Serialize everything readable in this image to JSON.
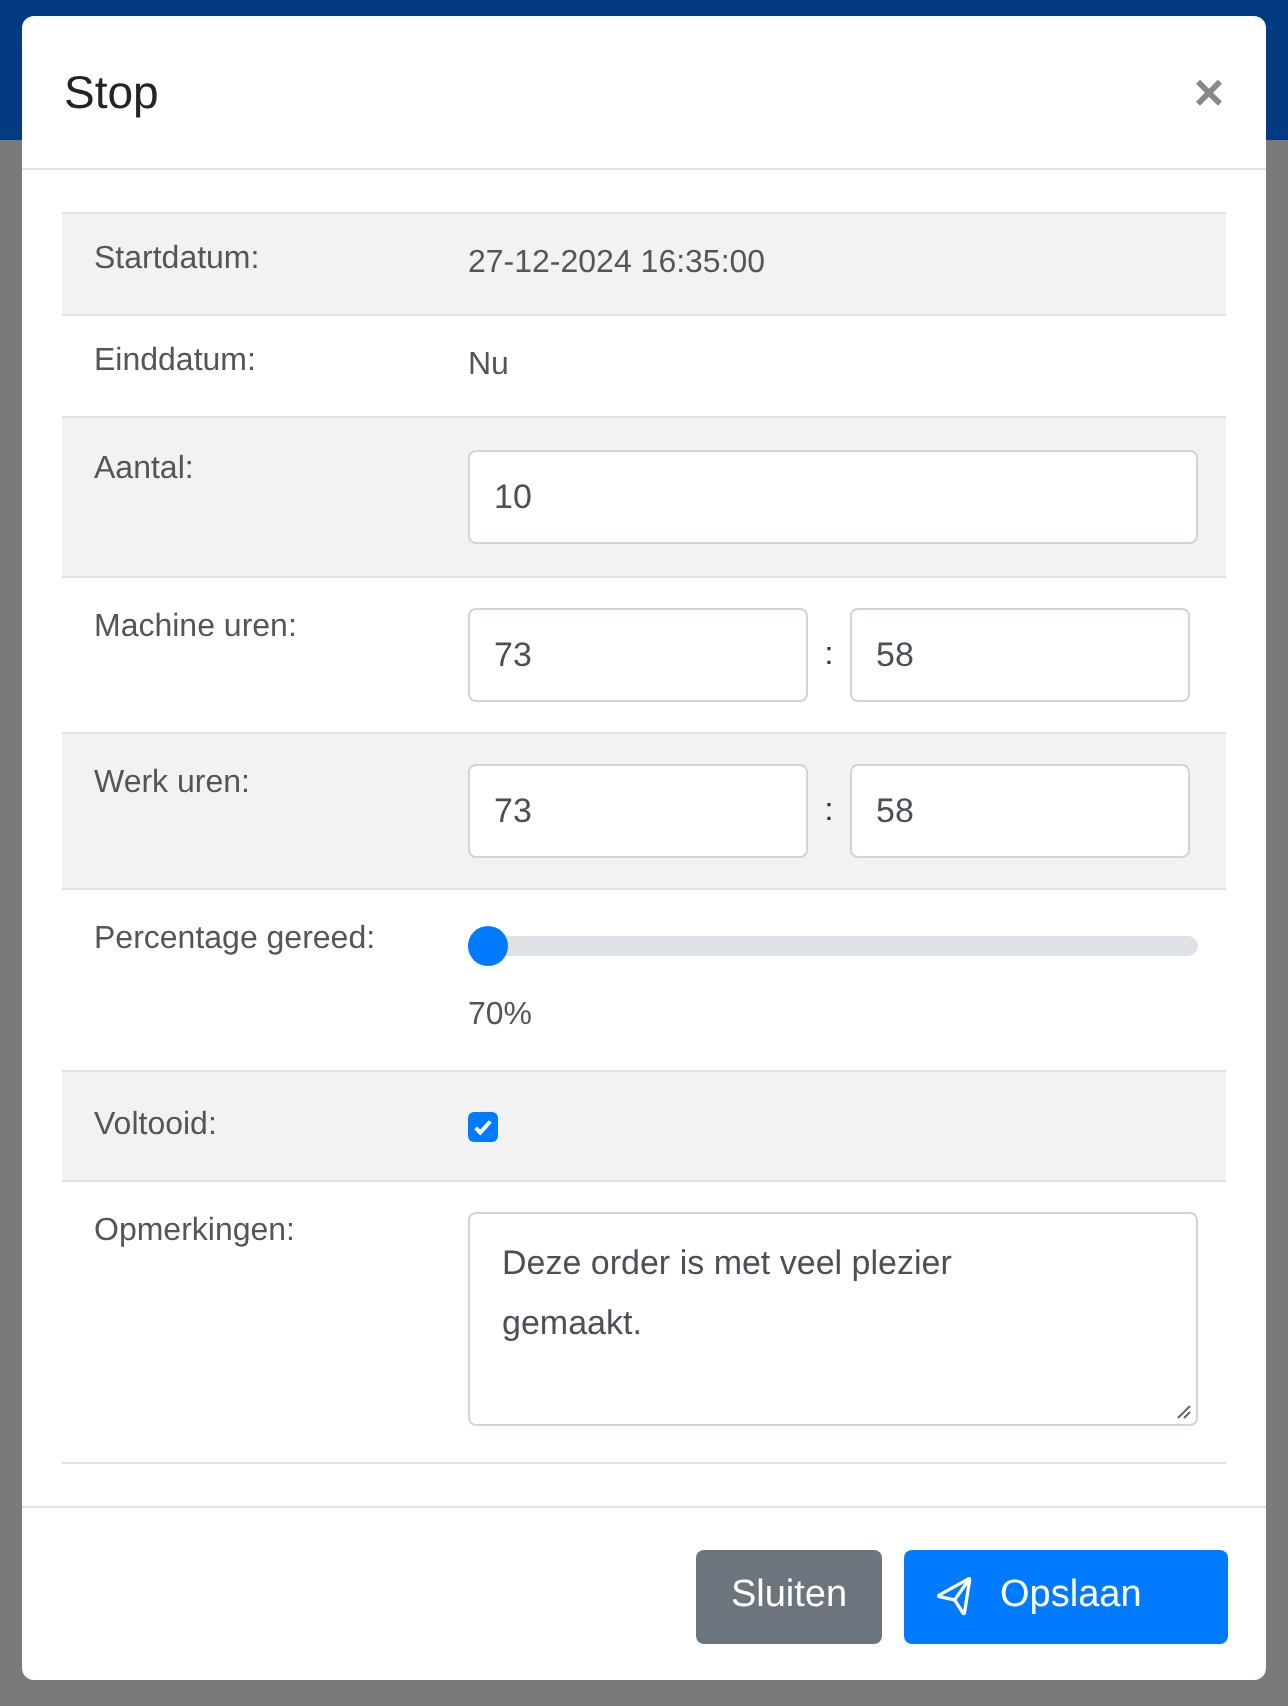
{
  "dialog": {
    "title": "Stop",
    "close": "×"
  },
  "rows": [
    {
      "kind": "text",
      "label": "Startdatum:",
      "value": "27-12-2024 16:35:00"
    },
    {
      "kind": "text",
      "label": "Einddatum:",
      "value": "Nu"
    },
    {
      "kind": "input",
      "label": "Aantal:",
      "value": "10"
    },
    {
      "kind": "time",
      "label": "Machine uren:",
      "hours": "73",
      "separator": ":",
      "minutes": "58"
    },
    {
      "kind": "time",
      "label": "Werk uren:",
      "hours": "73",
      "separator": ":",
      "minutes": "58"
    },
    {
      "kind": "slider",
      "label": "Percentage gereed:",
      "level": 0,
      "reading": "70%"
    },
    {
      "kind": "checkbox",
      "label": "Voltooid:",
      "checked": true
    },
    {
      "kind": "textarea",
      "label": "Opmerkingen:",
      "value": "Deze order is met veel plezier gemaakt."
    }
  ],
  "buttons": [
    {
      "kind": "secondary",
      "label": "Sluiten"
    },
    {
      "kind": "primary",
      "label": "Opslaan"
    }
  ]
}
